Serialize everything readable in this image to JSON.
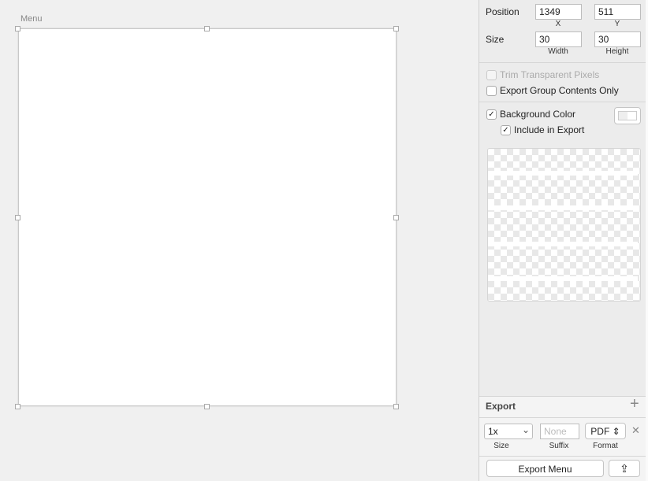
{
  "canvas": {
    "artboard_name": "Menu"
  },
  "inspector": {
    "position_label": "Position",
    "x": "1349",
    "y": "511",
    "x_label": "X",
    "y_label": "Y",
    "size_label": "Size",
    "width": "30",
    "height": "30",
    "width_label": "Width",
    "height_label": "Height",
    "trim_label": "Trim Transparent Pixels",
    "trim_checked": false,
    "trim_disabled": true,
    "group_label": "Export Group Contents Only",
    "group_checked": false,
    "bg_label": "Background Color",
    "bg_checked": true,
    "include_label": "Include in Export",
    "include_checked": true,
    "check_glyph": "✓"
  },
  "export": {
    "title": "Export",
    "add_glyph": "+",
    "size_value": "1x",
    "size_label": "Size",
    "suffix_placeholder": "None",
    "suffix_label": "Suffix",
    "format_value": "PDF",
    "format_label": "Format",
    "remove_glyph": "✕",
    "export_button": "Export Menu",
    "share_glyph": "⇪",
    "chevron": "⌄",
    "updown": "⇕"
  }
}
